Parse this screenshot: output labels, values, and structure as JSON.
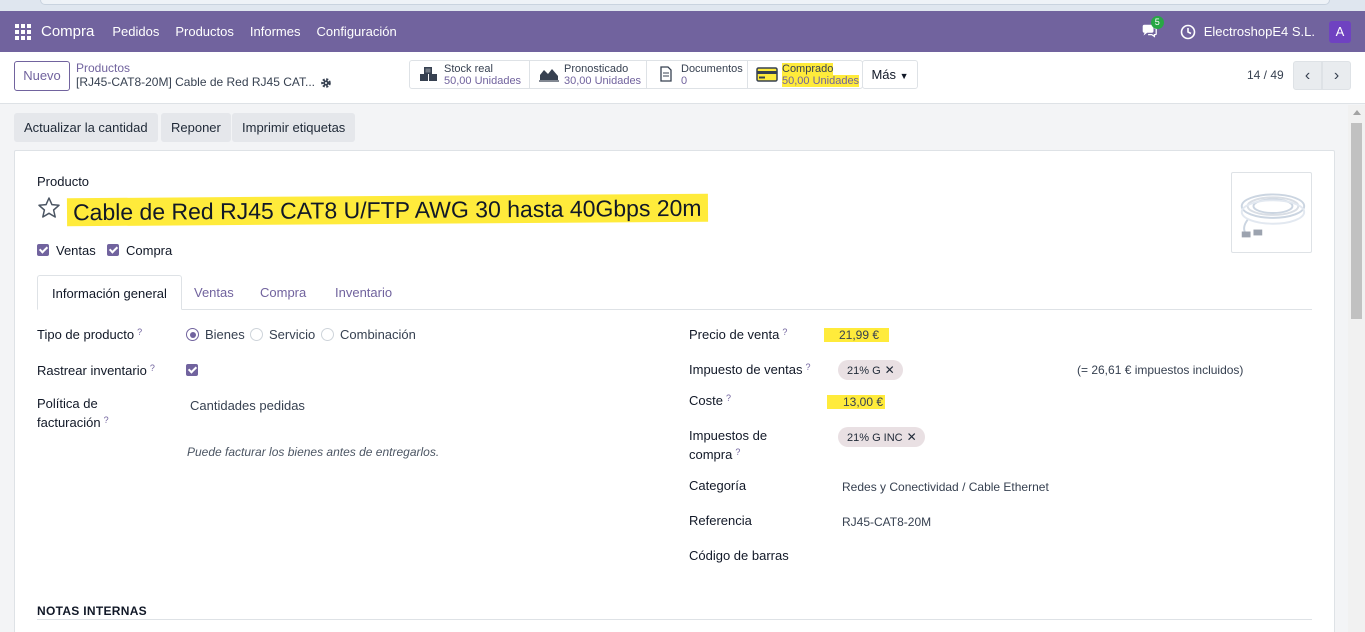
{
  "navbar": {
    "app_name": "Compra",
    "menu": [
      "Pedidos",
      "Productos",
      "Informes",
      "Configuración"
    ],
    "chat_badge": "5",
    "company": "ElectroshopE4 S.L.",
    "avatar_letter": "A"
  },
  "control": {
    "new_label": "Nuevo",
    "breadcrumb_parent": "Productos",
    "breadcrumb_current": "[RJ45-CAT8-20M] Cable de Red RJ45 CAT...",
    "stats": [
      {
        "label": "Stock real",
        "value": "50,00 Unidades",
        "icon": "cubes-icon"
      },
      {
        "label": "Pronosticado",
        "value": "30,00 Unidades",
        "icon": "area-chart-icon"
      },
      {
        "label": "Documentos",
        "value": "0",
        "icon": "document-icon"
      },
      {
        "label": "Comprado",
        "value": "50,00 Unidades",
        "icon": "credit-card-icon"
      }
    ],
    "more_label": "Más",
    "pager": "14 / 49"
  },
  "actions": {
    "update_qty": "Actualizar la cantidad",
    "replenish": "Reponer",
    "print_labels": "Imprimir etiquetas"
  },
  "product": {
    "section_label": "Producto",
    "name": "Cable de Red RJ45 CAT8 U/FTP AWG 30 hasta 40Gbps 20m",
    "can_be_sold_label": "Ventas",
    "can_be_purchased_label": "Compra"
  },
  "tabs": [
    "Información general",
    "Ventas",
    "Compra",
    "Inventario"
  ],
  "general": {
    "product_type_label": "Tipo de producto",
    "product_type_options": [
      "Bienes",
      "Servicio",
      "Combinación"
    ],
    "track_inventory_label": "Rastrear inventario",
    "invoice_policy_label_1": "Política de",
    "invoice_policy_label_2": "facturación",
    "invoice_policy_value": "Cantidades pedidas",
    "invoice_policy_help": "Puede facturar los bienes antes de entregarlos.",
    "sale_price_label": "Precio de venta",
    "sale_price_value": "21,99 €",
    "sales_tax_label": "Impuesto de ventas",
    "sales_tax_tag": "21% G",
    "tax_included_note": "(= 26,61 € impuestos incluidos)",
    "cost_label": "Coste",
    "cost_value": "13,00 €",
    "purchase_tax_label_1": "Impuestos de",
    "purchase_tax_label_2": "compra",
    "purchase_tax_tag": "21% G INC",
    "category_label": "Categoría",
    "category_value": "Redes y Conectividad / Cable Ethernet",
    "reference_label": "Referencia",
    "reference_value": "RJ45-CAT8-20M",
    "barcode_label": "Código de barras",
    "barcode_value": "",
    "internal_notes_label": "NOTAS INTERNAS",
    "help_mark": "?"
  }
}
